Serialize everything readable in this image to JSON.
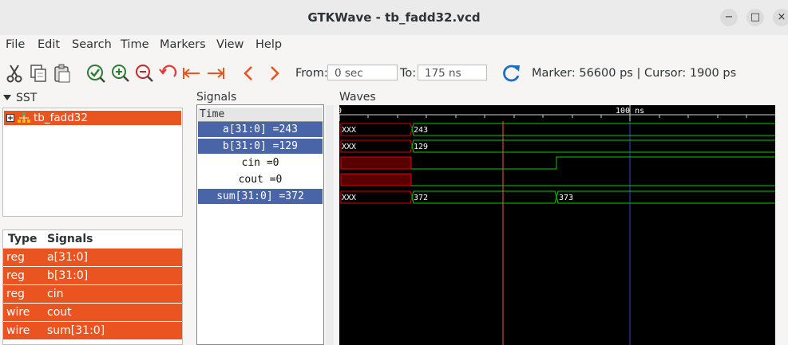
{
  "window": {
    "title": "GTKWave - tb_fadd32.vcd",
    "minimize_glyph": "−",
    "maximize_glyph": "□",
    "close_glyph": "×"
  },
  "menu": [
    "File",
    "Edit",
    "Search",
    "Time",
    "Markers",
    "View",
    "Help"
  ],
  "toolbar": {
    "icons": [
      "cut-icon",
      "copy-icon",
      "paste-icon",
      "zoom-fit-icon",
      "zoom-in-icon",
      "zoom-out-icon",
      "undo-icon",
      "go-start-icon",
      "go-end-icon",
      "previous-icon",
      "next-icon",
      "reload-icon"
    ],
    "from_label": "From:",
    "from_value": "0 sec",
    "to_label": "To:",
    "to_value": "175 ns",
    "status": "Marker: 56600 ps  |  Cursor: 1900 ps"
  },
  "sst": {
    "label": "SST",
    "tree": [
      {
        "label": "tb_fadd32"
      }
    ]
  },
  "signal_types": {
    "headers": [
      "Type",
      "Signals"
    ],
    "rows": [
      {
        "type": "reg",
        "name": "a[31:0]"
      },
      {
        "type": "reg",
        "name": "b[31:0]"
      },
      {
        "type": "reg",
        "name": "cin"
      },
      {
        "type": "wire",
        "name": "cout"
      },
      {
        "type": "wire",
        "name": "sum[31:0]"
      }
    ]
  },
  "signals_panel": {
    "label": "Signals",
    "time_header": "Time",
    "rows": [
      {
        "text": "a[31:0] =243",
        "selected": true
      },
      {
        "text": "b[31:0] =129",
        "selected": true
      },
      {
        "text": "cin =0",
        "selected": false
      },
      {
        "text": "cout =0",
        "selected": false
      },
      {
        "text": "sum[31:0] =372",
        "selected": true
      }
    ]
  },
  "waves": {
    "label": "Waves",
    "time_start_label": "0",
    "time_marker_label": "100 ns",
    "traces": {
      "a": [
        "XXX",
        "243"
      ],
      "b": [
        "XXX",
        "129"
      ],
      "sum": [
        "XXX",
        "372",
        "373"
      ]
    },
    "colors": {
      "background": "#000000",
      "trace": "#00d000",
      "undefined": "#e00000",
      "marker": "#ff5050",
      "cursor": "#3b3bd8"
    }
  }
}
